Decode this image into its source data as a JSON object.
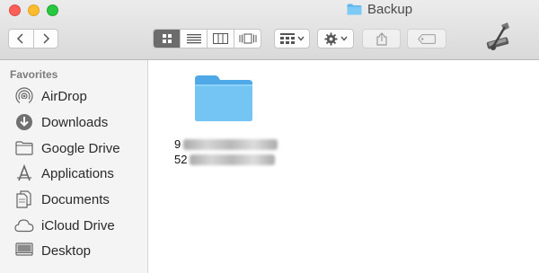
{
  "window": {
    "title": "Backup"
  },
  "toolbar": {
    "back_icon": "chevron-left-icon",
    "forward_icon": "chevron-right-icon",
    "views": [
      "icon-view",
      "list-view",
      "column-view",
      "cover-flow-view"
    ],
    "active_view": "icon-view",
    "arrange_icon": "arrange-grid-icon",
    "action_icon": "gear-icon",
    "share_icon": "share-icon",
    "tag_icon": "tag-icon"
  },
  "sidebar": {
    "heading": "Favorites",
    "items": [
      {
        "label": "AirDrop",
        "icon": "airdrop-icon"
      },
      {
        "label": "Downloads",
        "icon": "downloads-icon"
      },
      {
        "label": "Google Drive",
        "icon": "folder-icon"
      },
      {
        "label": "Applications",
        "icon": "applications-icon"
      },
      {
        "label": "Documents",
        "icon": "documents-icon"
      },
      {
        "label": "iCloud Drive",
        "icon": "cloud-icon"
      },
      {
        "label": "Desktop",
        "icon": "desktop-icon"
      }
    ]
  },
  "main": {
    "folder": {
      "name_line1_visible": "9",
      "name_line2_visible": "52"
    }
  },
  "colors": {
    "folder_blue": "#6cc1f0",
    "toolbar_bg": "#dedede",
    "sidebar_bg": "#f4f4f4"
  }
}
